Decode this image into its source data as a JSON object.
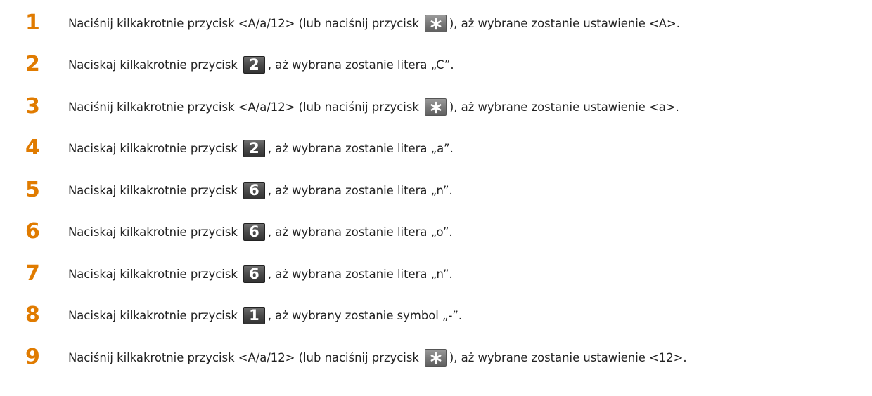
{
  "steps": [
    {
      "num": "1",
      "before": "Naciśnij kilkakrotnie przycisk <A/a/12> (lub naciśnij przycisk",
      "key": "*",
      "key_icon": "asterisk-key-icon",
      "after": "), aż wybrane zostanie ustawienie <A>."
    },
    {
      "num": "2",
      "before": "Naciskaj kilkakrotnie przycisk",
      "key": "2",
      "key_icon": "key-2-icon",
      "after": ", aż wybrana zostanie litera „C”."
    },
    {
      "num": "3",
      "before": "Naciśnij kilkakrotnie przycisk <A/a/12> (lub naciśnij przycisk",
      "key": "*",
      "key_icon": "asterisk-key-icon",
      "after": "), aż wybrane zostanie ustawienie <a>."
    },
    {
      "num": "4",
      "before": "Naciskaj kilkakrotnie przycisk",
      "key": "2",
      "key_icon": "key-2-icon",
      "after": ", aż wybrana zostanie litera „a”."
    },
    {
      "num": "5",
      "before": "Naciskaj kilkakrotnie przycisk",
      "key": "6",
      "key_icon": "key-6-icon",
      "after": ", aż wybrana zostanie litera „n”."
    },
    {
      "num": "6",
      "before": "Naciskaj kilkakrotnie przycisk",
      "key": "6",
      "key_icon": "key-6-icon",
      "after": ", aż wybrana zostanie litera „o”."
    },
    {
      "num": "7",
      "before": "Naciskaj kilkakrotnie przycisk",
      "key": "6",
      "key_icon": "key-6-icon",
      "after": ", aż wybrana zostanie litera „n”."
    },
    {
      "num": "8",
      "before": "Naciskaj kilkakrotnie przycisk",
      "key": "1",
      "key_icon": "key-1-icon",
      "after": ", aż wybrany zostanie symbol „-”."
    },
    {
      "num": "9",
      "before": "Naciśnij kilkakrotnie przycisk <A/a/12> (lub naciśnij przycisk",
      "key": "*",
      "key_icon": "asterisk-key-icon",
      "after": "), aż wybrane zostanie ustawienie <12>."
    }
  ],
  "colors": {
    "step_number": "#e07b00",
    "text": "#222222",
    "key_dark": "#4a4a4a",
    "key_light": "#7a7a7a"
  }
}
